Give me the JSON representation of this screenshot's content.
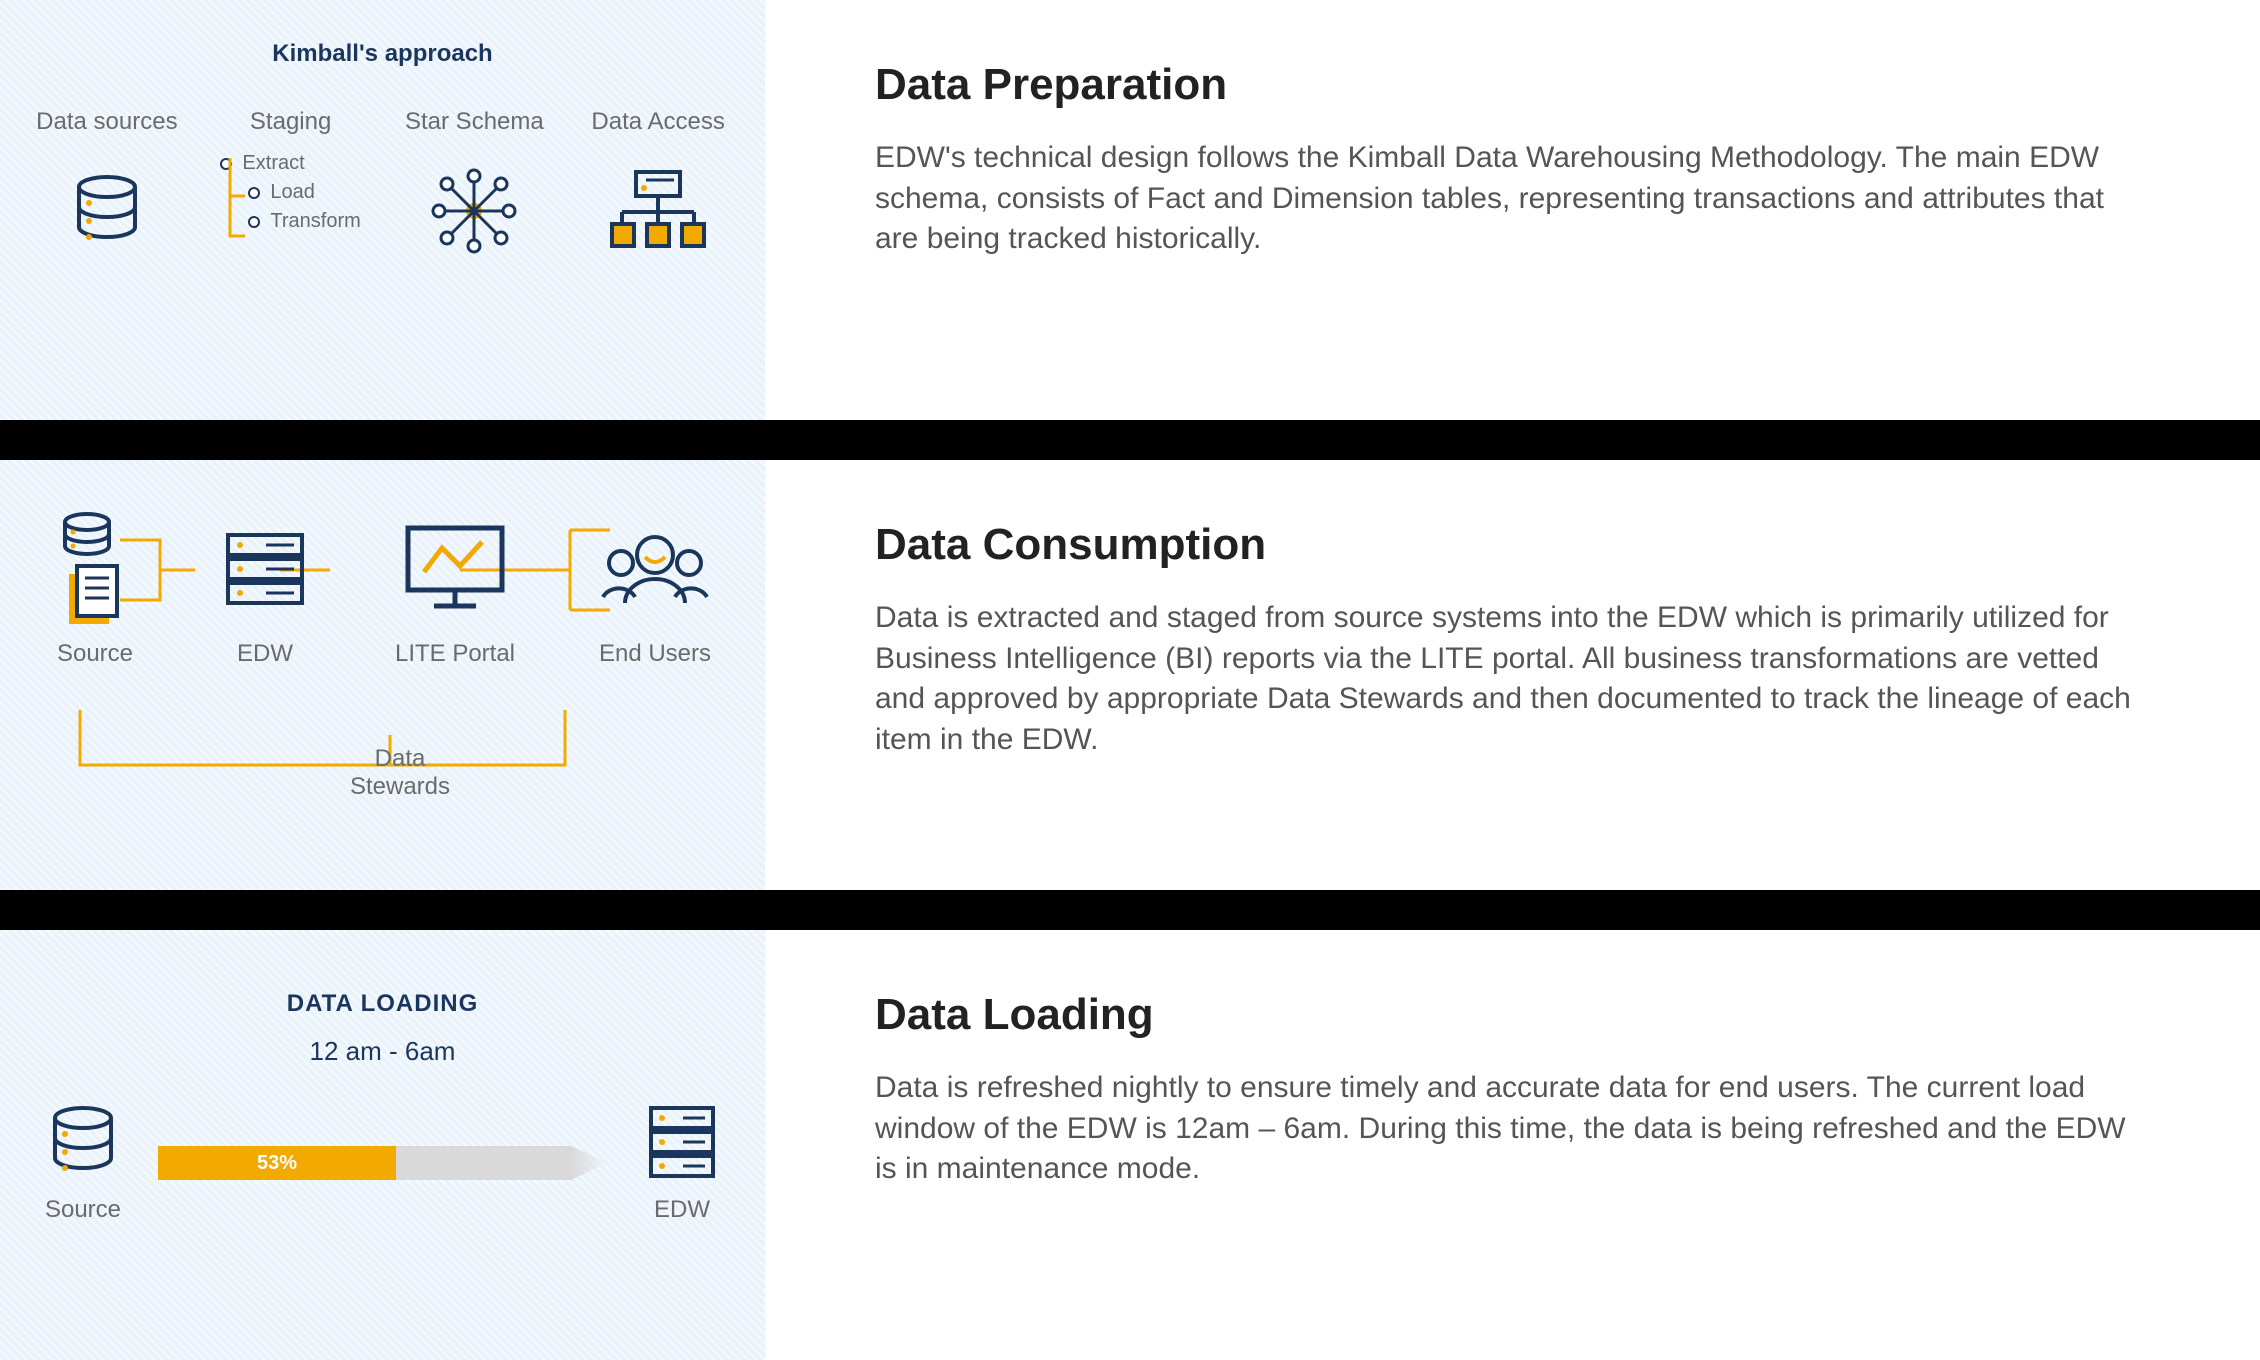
{
  "row1": {
    "diagram_title": "Kimball's approach",
    "cols": {
      "c1": "Data sources",
      "c2": "Staging",
      "c3": "Star Schema",
      "c4": "Data Access"
    },
    "etl": {
      "e": "Extract",
      "l": "Load",
      "t": "Transform"
    },
    "heading": "Data Preparation",
    "body": "EDW's technical design follows the Kimball Data Warehousing Methodology. The main EDW schema, consists of Fact and Dimension tables, representing transactions and attributes that are being tracked historically."
  },
  "row2": {
    "labels": {
      "source": "Source",
      "edw": "EDW",
      "portal": "LITE Portal",
      "endusers": "End Users",
      "stewards": "Data\nStewards"
    },
    "heading": "Data Consumption",
    "body": "Data is extracted and staged from source systems into the EDW which is primarily utilized for Business Intelligence (BI) reports via the LITE portal. All business transformations are vetted and approved by appropriate Data Stewards and then documented to track the lineage of each item in the EDW."
  },
  "row3": {
    "diagram_title": "DATA LOADING",
    "time_window": "12 am - 6am",
    "progress_pct": 53,
    "progress_label": "53%",
    "source_label": "Source",
    "edw_label": "EDW",
    "heading": "Data Loading",
    "body": "Data is refreshed nightly to ensure timely and accurate data for end users. The current load window of the EDW is 12am – 6am. During this time, the data is being refreshed and the EDW is in maintenance mode."
  }
}
